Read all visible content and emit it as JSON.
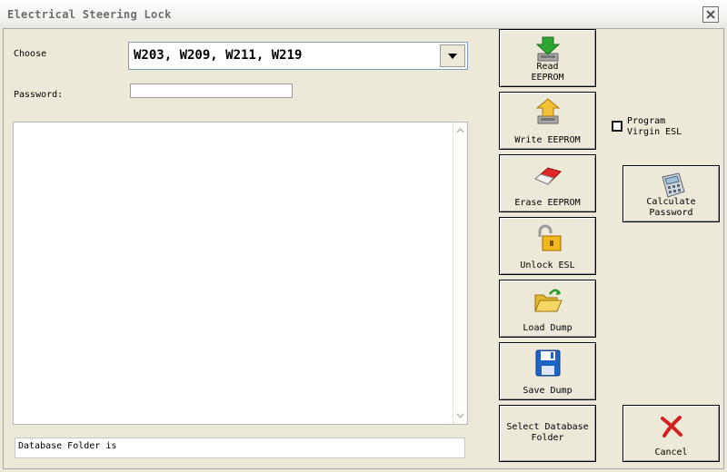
{
  "window": {
    "title": "Electrical Steering Lock"
  },
  "form": {
    "choose_label": "Choose",
    "choose_value": "W203, W209, W211, W219",
    "password_label": "Password:",
    "password_value": ""
  },
  "status": {
    "text": "Database Folder is"
  },
  "buttons": {
    "read_eeprom": "Read\nEEPROM",
    "write_eeprom": "Write EEPROM",
    "erase_eeprom": "Erase EEPROM",
    "unlock_esl": "Unlock ESL",
    "load_dump": "Load Dump",
    "save_dump": "Save Dump",
    "select_db": "Select Database\nFolder",
    "calculate_password": "Calculate\nPassword",
    "cancel": "Cancel"
  },
  "options": {
    "program_virgin_label": "Program\nVirgin ESL",
    "program_virgin_checked": false
  },
  "icons": {
    "read": "download-chip-icon",
    "write": "upload-chip-icon",
    "erase": "eraser-icon",
    "unlock": "padlock-open-icon",
    "load": "folder-open-icon",
    "save": "floppy-disk-icon",
    "calculate": "calculator-icon",
    "cancel": "red-x-icon"
  }
}
